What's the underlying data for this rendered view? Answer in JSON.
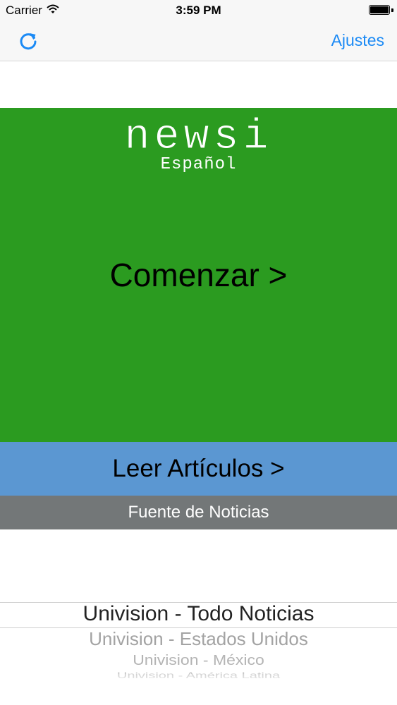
{
  "status_bar": {
    "carrier": "Carrier",
    "time": "3:59 PM"
  },
  "nav": {
    "settings_label": "Ajustes",
    "refresh_icon": "refresh-icon"
  },
  "hero": {
    "logo": "newsi",
    "logo_sub": "Español",
    "start_label": "Comenzar >",
    "background": "#2b9b20"
  },
  "read_button": {
    "label": "Leer Artículos >",
    "background": "#5b97d2"
  },
  "source_bar": {
    "label": "Fuente de Noticias",
    "background": "#737778"
  },
  "picker": {
    "selected": "Univision - Todo Noticias",
    "options": [
      "Univision - Todo Noticias",
      "Univision - Estados Unidos",
      "Univision - México",
      "Univision - América Latina"
    ]
  },
  "colors": {
    "accent": "#1b8af5"
  }
}
